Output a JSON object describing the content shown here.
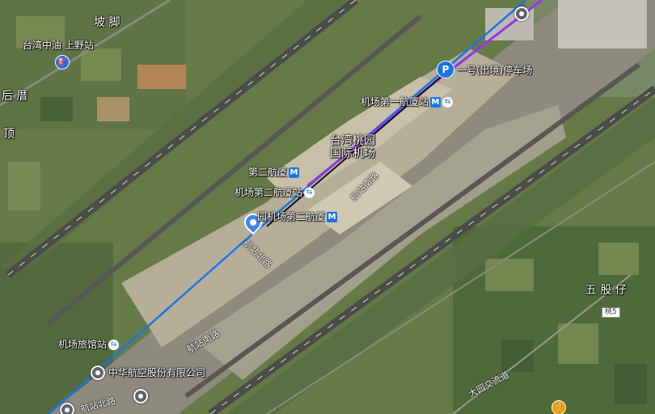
{
  "labels": {
    "poshoe": "坡 脚",
    "cpc_station": "台湾中油 上野站",
    "houcuo": "后 厝",
    "ding": "顶",
    "parking": "一号(出境)停车场",
    "t1_station": "机场第一航厦站",
    "airport_line1": "台湾桃园",
    "airport_line2": "国际机场",
    "t2_station_short": "第二航厦",
    "t2_rail_station": "机场第二航厦站",
    "t2_metro": "园机场第二航厦",
    "hangzhan_south_1": "航站南路",
    "hangzhan_north_1": "航站北路",
    "hangzhan_south_2": "航站南路",
    "hotel_station": "机场旅馆站",
    "china_airlines": "中华航空股份有限公司",
    "hangzhan_north_2": "航站北路",
    "wuguzai": "五 股 仔",
    "route_tao5": "桃5",
    "partial_label": "大园交流道"
  },
  "icons": {
    "metro_glyph": "M",
    "parking_glyph": "P",
    "rail_glyph": "⇆",
    "fuel_glyph": "⛽",
    "food_glyph": "🍴"
  },
  "colors": {
    "metro_line": "#1a73e8",
    "rail_line": "#9334e6",
    "accent": "#4285f4"
  }
}
